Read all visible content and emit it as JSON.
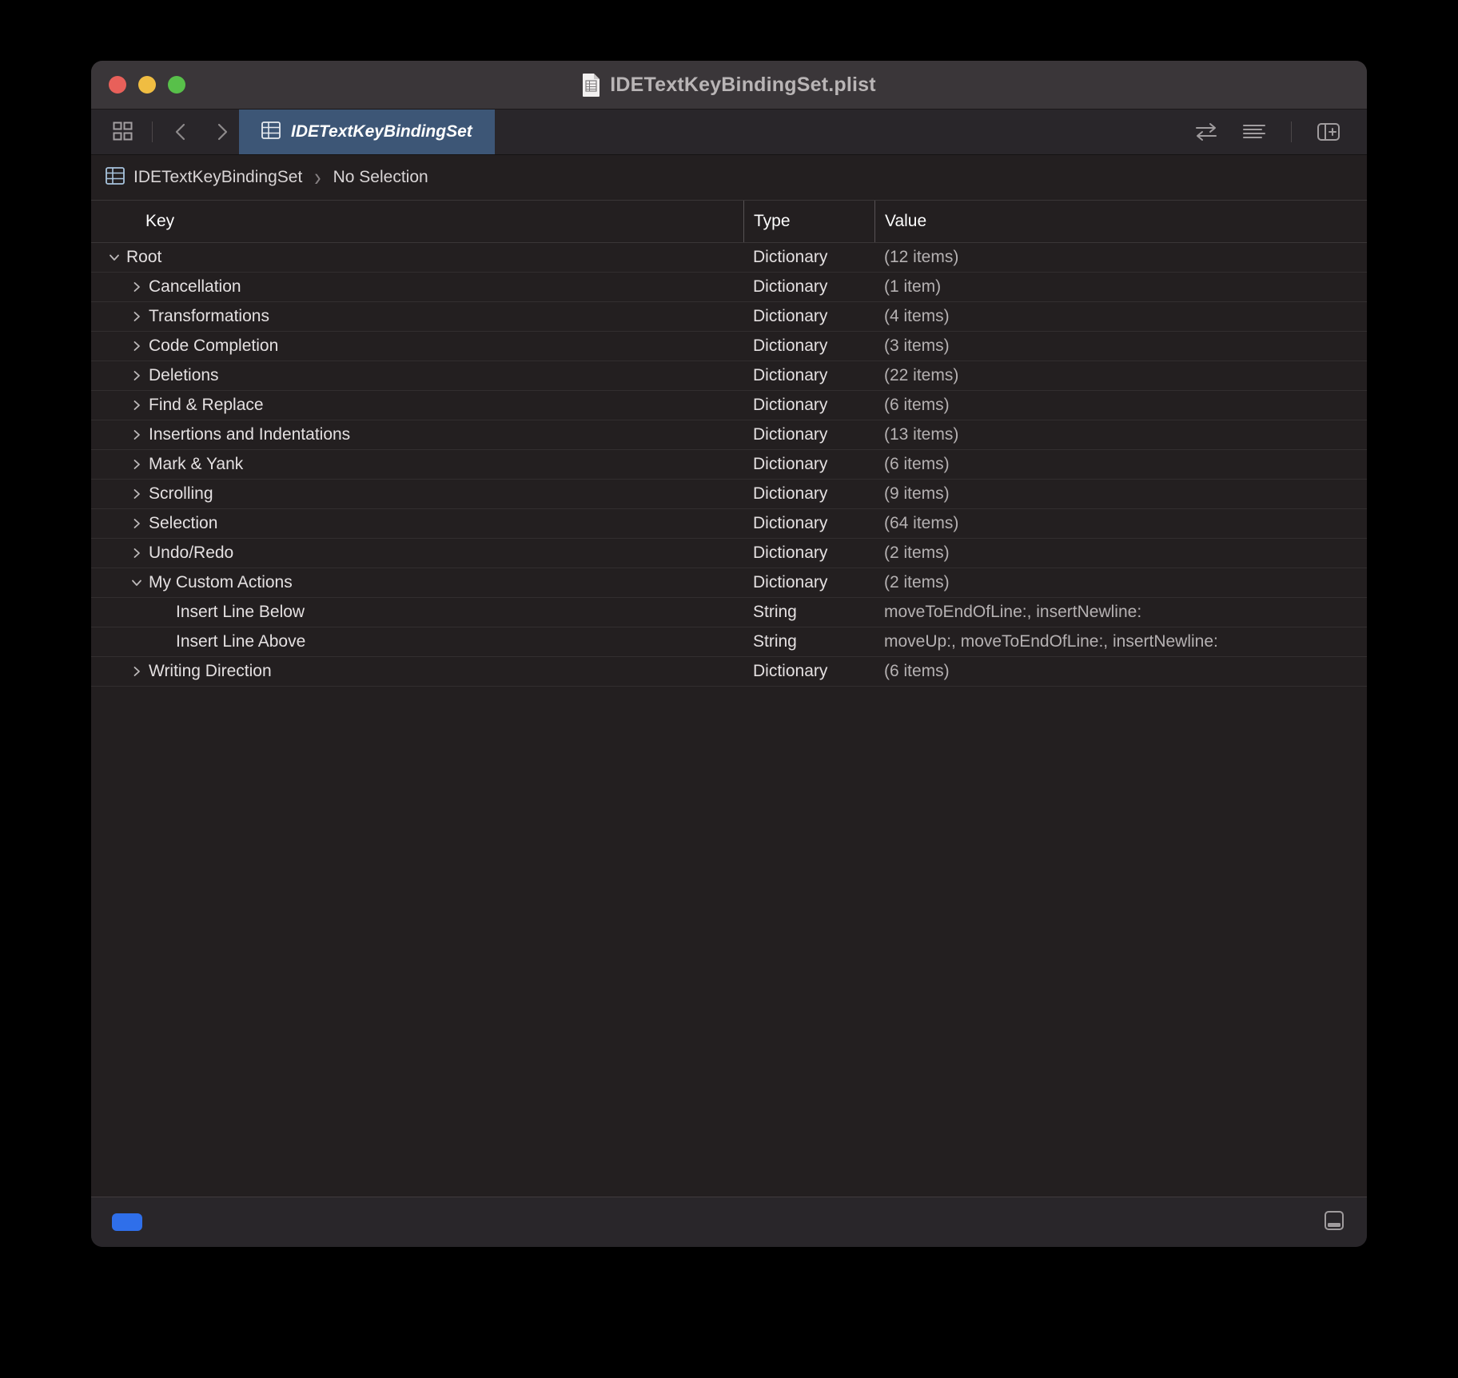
{
  "window": {
    "title": "IDETextKeyBindingSet.plist",
    "title_icon": "plist-document-icon",
    "traffic_lights": [
      {
        "name": "close",
        "color": "#e8605a"
      },
      {
        "name": "minimize",
        "color": "#f0bd42"
      },
      {
        "name": "zoom",
        "color": "#58c04a"
      }
    ]
  },
  "toolbar": {
    "grid_icon": "grid-view-icon",
    "back_icon": "chevron-left-icon",
    "forward_icon": "chevron-right-icon",
    "swap_icon": "swap-arrows-icon",
    "list_icon": "list-lines-icon",
    "panel_icon": "add-panel-icon",
    "tab": {
      "label": "IDETextKeyBindingSet",
      "icon": "table-grid-icon",
      "active_color": "#3d5676"
    }
  },
  "breadcrumb": {
    "icon": "table-grid-icon",
    "root": "IDETextKeyBindingSet",
    "separator": "›",
    "selection": "No Selection"
  },
  "table": {
    "columns": [
      "Key",
      "Type",
      "Value"
    ],
    "rows": [
      {
        "key": "Root",
        "type": "Dictionary",
        "value": "(12 items)",
        "indent": 0,
        "disclosure": "expanded"
      },
      {
        "key": "Cancellation",
        "type": "Dictionary",
        "value": "(1 item)",
        "indent": 1,
        "disclosure": "collapsed"
      },
      {
        "key": "Transformations",
        "type": "Dictionary",
        "value": "(4 items)",
        "indent": 1,
        "disclosure": "collapsed"
      },
      {
        "key": "Code Completion",
        "type": "Dictionary",
        "value": "(3 items)",
        "indent": 1,
        "disclosure": "collapsed"
      },
      {
        "key": "Deletions",
        "type": "Dictionary",
        "value": "(22 items)",
        "indent": 1,
        "disclosure": "collapsed"
      },
      {
        "key": "Find & Replace",
        "type": "Dictionary",
        "value": "(6 items)",
        "indent": 1,
        "disclosure": "collapsed"
      },
      {
        "key": "Insertions and Indentations",
        "type": "Dictionary",
        "value": "(13 items)",
        "indent": 1,
        "disclosure": "collapsed"
      },
      {
        "key": "Mark & Yank",
        "type": "Dictionary",
        "value": "(6 items)",
        "indent": 1,
        "disclosure": "collapsed"
      },
      {
        "key": "Scrolling",
        "type": "Dictionary",
        "value": "(9 items)",
        "indent": 1,
        "disclosure": "collapsed"
      },
      {
        "key": "Selection",
        "type": "Dictionary",
        "value": "(64 items)",
        "indent": 1,
        "disclosure": "collapsed"
      },
      {
        "key": "Undo/Redo",
        "type": "Dictionary",
        "value": "(2 items)",
        "indent": 1,
        "disclosure": "collapsed"
      },
      {
        "key": "My Custom Actions",
        "type": "Dictionary",
        "value": "(2 items)",
        "indent": 1,
        "disclosure": "expanded"
      },
      {
        "key": "Insert Line Below",
        "type": "String",
        "value": "moveToEndOfLine:, insertNewline:",
        "indent": 2,
        "disclosure": "none"
      },
      {
        "key": "Insert Line Above",
        "type": "String",
        "value": "moveUp:, moveToEndOfLine:, insertNewline:",
        "indent": 2,
        "disclosure": "none"
      },
      {
        "key": "Writing Direction",
        "type": "Dictionary",
        "value": "(6 items)",
        "indent": 1,
        "disclosure": "collapsed"
      }
    ]
  },
  "statusbar": {
    "toggle_color": "#2f6fea",
    "toggle_name": "blue-pill-toggle",
    "panel_icon": "show-bottom-panel-icon"
  }
}
